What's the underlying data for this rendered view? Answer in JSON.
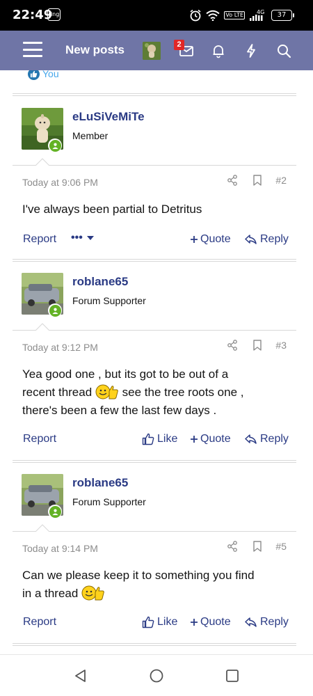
{
  "status_bar": {
    "time": "22:49",
    "app_badge": "ring",
    "network": "4G",
    "volte": "Vo LTE",
    "battery": "37",
    "icons": [
      "alarm-icon",
      "wifi-icon",
      "volte-icon",
      "signal-icon",
      "battery-icon"
    ]
  },
  "nav": {
    "menu_icon": "hamburger-icon",
    "title": "New posts",
    "message_badge": "2",
    "icons": [
      "avatar",
      "envelope-icon",
      "bell-icon",
      "bolt-icon",
      "search-icon"
    ],
    "color": "#6f75a6"
  },
  "reactions": {
    "label": "You",
    "icon": "thumbs-up-icon"
  },
  "posts": [
    {
      "username": "eLuSiVeMiTe",
      "user_title": "Member",
      "date": "Today at 9:06 PM",
      "number": "#2",
      "body": "I've always been partial to Detritus",
      "actions": {
        "report": "Report",
        "more": "•••",
        "quote": "Quote",
        "reply": "Reply"
      }
    },
    {
      "username": "roblane65",
      "user_title": "Forum Supporter",
      "date": "Today at 9:12 PM",
      "number": "#3",
      "body_line1": "Yea good one , but its got to be out of a",
      "body_line2a": "recent thread",
      "body_line2b": " see the tree roots one ,",
      "body_line3": "there's been a few the last few days .",
      "actions": {
        "report": "Report",
        "like": "Like",
        "quote": "Quote",
        "reply": "Reply"
      }
    },
    {
      "username": "roblane65",
      "user_title": "Forum Supporter",
      "date": "Today at 9:14 PM",
      "number": "#5",
      "body_line1": "Can we please keep it to something you find",
      "body_line2": "in a thread",
      "actions": {
        "report": "Report",
        "like": "Like",
        "quote": "Quote",
        "reply": "Reply"
      }
    }
  ],
  "colors": {
    "link": "#2a3a84",
    "online": "#63b224",
    "meta": "#8c8c8c",
    "like_blue": "#47a7eb"
  },
  "system_nav": [
    "back-icon",
    "home-icon",
    "recents-icon"
  ]
}
